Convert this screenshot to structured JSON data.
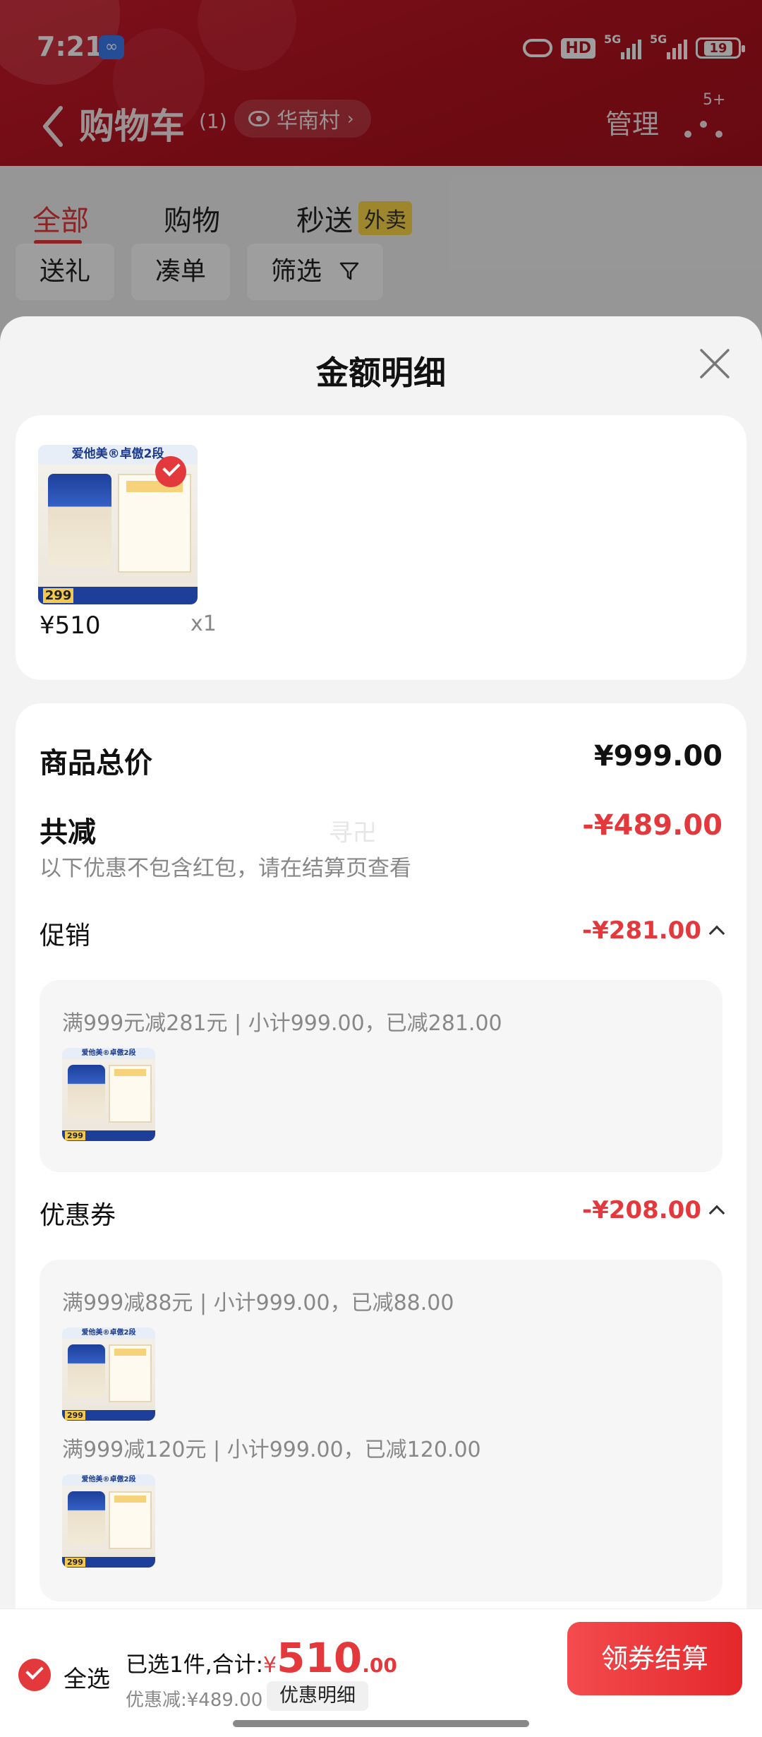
{
  "status_bar": {
    "time": "7:21",
    "hd_label": "HD",
    "signal_1_label": "5G",
    "signal_2_label": "5G",
    "battery": "19"
  },
  "nav": {
    "title": "购物车",
    "count": "(1)",
    "location": "华南村",
    "manage": "管理",
    "more_badge": "5+"
  },
  "tabs": [
    {
      "label": "全部",
      "active": true
    },
    {
      "label": "购物",
      "active": false
    },
    {
      "label": "秒送",
      "active": false,
      "tag": "外卖"
    }
  ],
  "chips": [
    "送礼",
    "凑单",
    "筛选"
  ],
  "sheet": {
    "title": "金额明细",
    "product": {
      "header_text": "爱他美®卓傲2段",
      "price_tag": "299",
      "price": "¥510",
      "quantity": "x1"
    },
    "total_label": "商品总价",
    "total_value": "¥999.00",
    "reduce_label": "共减",
    "reduce_value": "-¥489.00",
    "watermark": "寻卍",
    "hint": "以下优惠不包含红包，请在结算页查看",
    "promotion": {
      "label": "促销",
      "value": "-¥281.00",
      "items": [
        {
          "text": "满999元减281元 | 小计999.00，已减281.00"
        }
      ]
    },
    "coupon": {
      "label": "优惠券",
      "value": "-¥208.00",
      "items": [
        {
          "text": "满999减88元 | 小计999.00，已减88.00"
        },
        {
          "text": "满999减120元 | 小计999.00，已减120.00"
        }
      ]
    }
  },
  "bottom_bar": {
    "select_all": "全选",
    "selected_prefix": "已选1件,合计:",
    "currency": "¥",
    "total_int": "510",
    "total_dec": ".00",
    "saved": "优惠减:¥489.00",
    "detail_button": "优惠明细",
    "checkout_button": "领券结算"
  },
  "colors": {
    "brand_red": "#e4393c",
    "header_red": "#b3121f"
  }
}
